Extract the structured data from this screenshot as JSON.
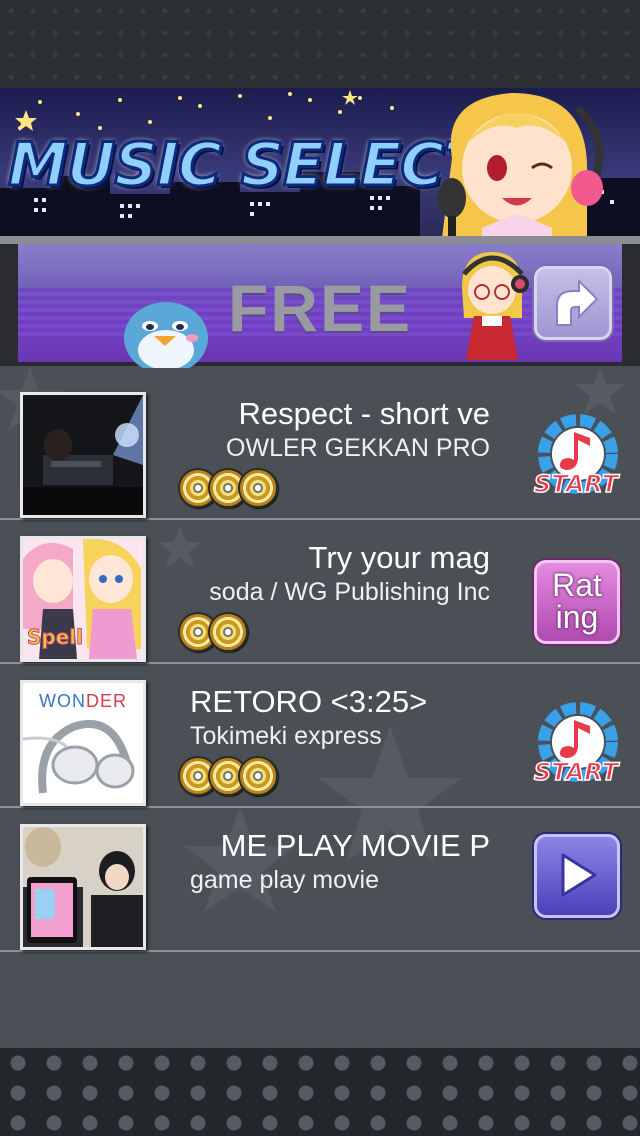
{
  "header": {
    "title": "MUSIC SELECT"
  },
  "free_bar": {
    "label": "FREE",
    "back_icon": "curved-arrow-icon"
  },
  "songs": [
    {
      "title": "Respect - short ve",
      "artist": "OWLER     GEKKAN PRO",
      "discs": 3,
      "action": "START",
      "thumb_icon": "concert-photo"
    },
    {
      "title": "Try your mag",
      "artist": "soda / WG Publishing Inc",
      "discs": 2,
      "action_lines": [
        "Rat",
        "ing"
      ],
      "thumb_icon": "anime-girls-art",
      "thumb_label": "Spell"
    },
    {
      "title": "RETORO <3:25>",
      "artist": "Tokimeki express",
      "discs": 3,
      "action": "START",
      "thumb_icon": "headphones-photo",
      "thumb_label": "WONDER"
    },
    {
      "title": "ME PLAY MOVIE P",
      "artist": "game play movie",
      "discs": 0,
      "action_icon": "play-icon",
      "thumb_icon": "people-photo"
    }
  ]
}
